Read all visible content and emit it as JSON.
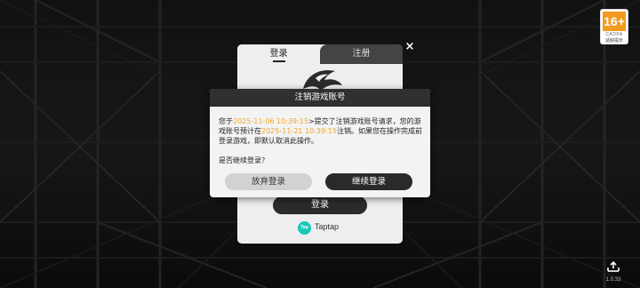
{
  "age_rating": {
    "number": "16+",
    "code": "CADPA",
    "label": "适龄提示"
  },
  "login_panel": {
    "tabs": [
      {
        "label": "登录",
        "active": true
      },
      {
        "label": "注册",
        "active": false
      }
    ],
    "login_button_label": "登录",
    "taptap": {
      "icon_text": "Tap",
      "label": "Taptap"
    }
  },
  "close_icon": "×",
  "dialog": {
    "title": "注销游戏账号",
    "line1_prefix": "您于",
    "request_time": "2025-11-06 10:39:15",
    "line1_suffix": ">提交了注销游戏账号请求，",
    "line2_prefix": "您的游戏账号预计在",
    "cancel_time": "2025-11-21 10:39:15",
    "line2_suffix": "注销。如果您在操作完成前登录游戏，即默认取消此操作。",
    "question": "是否继续登录？",
    "abandon_button": "放弃登录",
    "continue_button": "继续登录"
  },
  "footer": {
    "version": "1.0.33",
    "exit_icon": "exit-icon"
  },
  "colors": {
    "highlight": "#f5a524",
    "dialog_header": "#303030",
    "age_badge": "#f39a1f",
    "taptap": "#19c8b8"
  }
}
